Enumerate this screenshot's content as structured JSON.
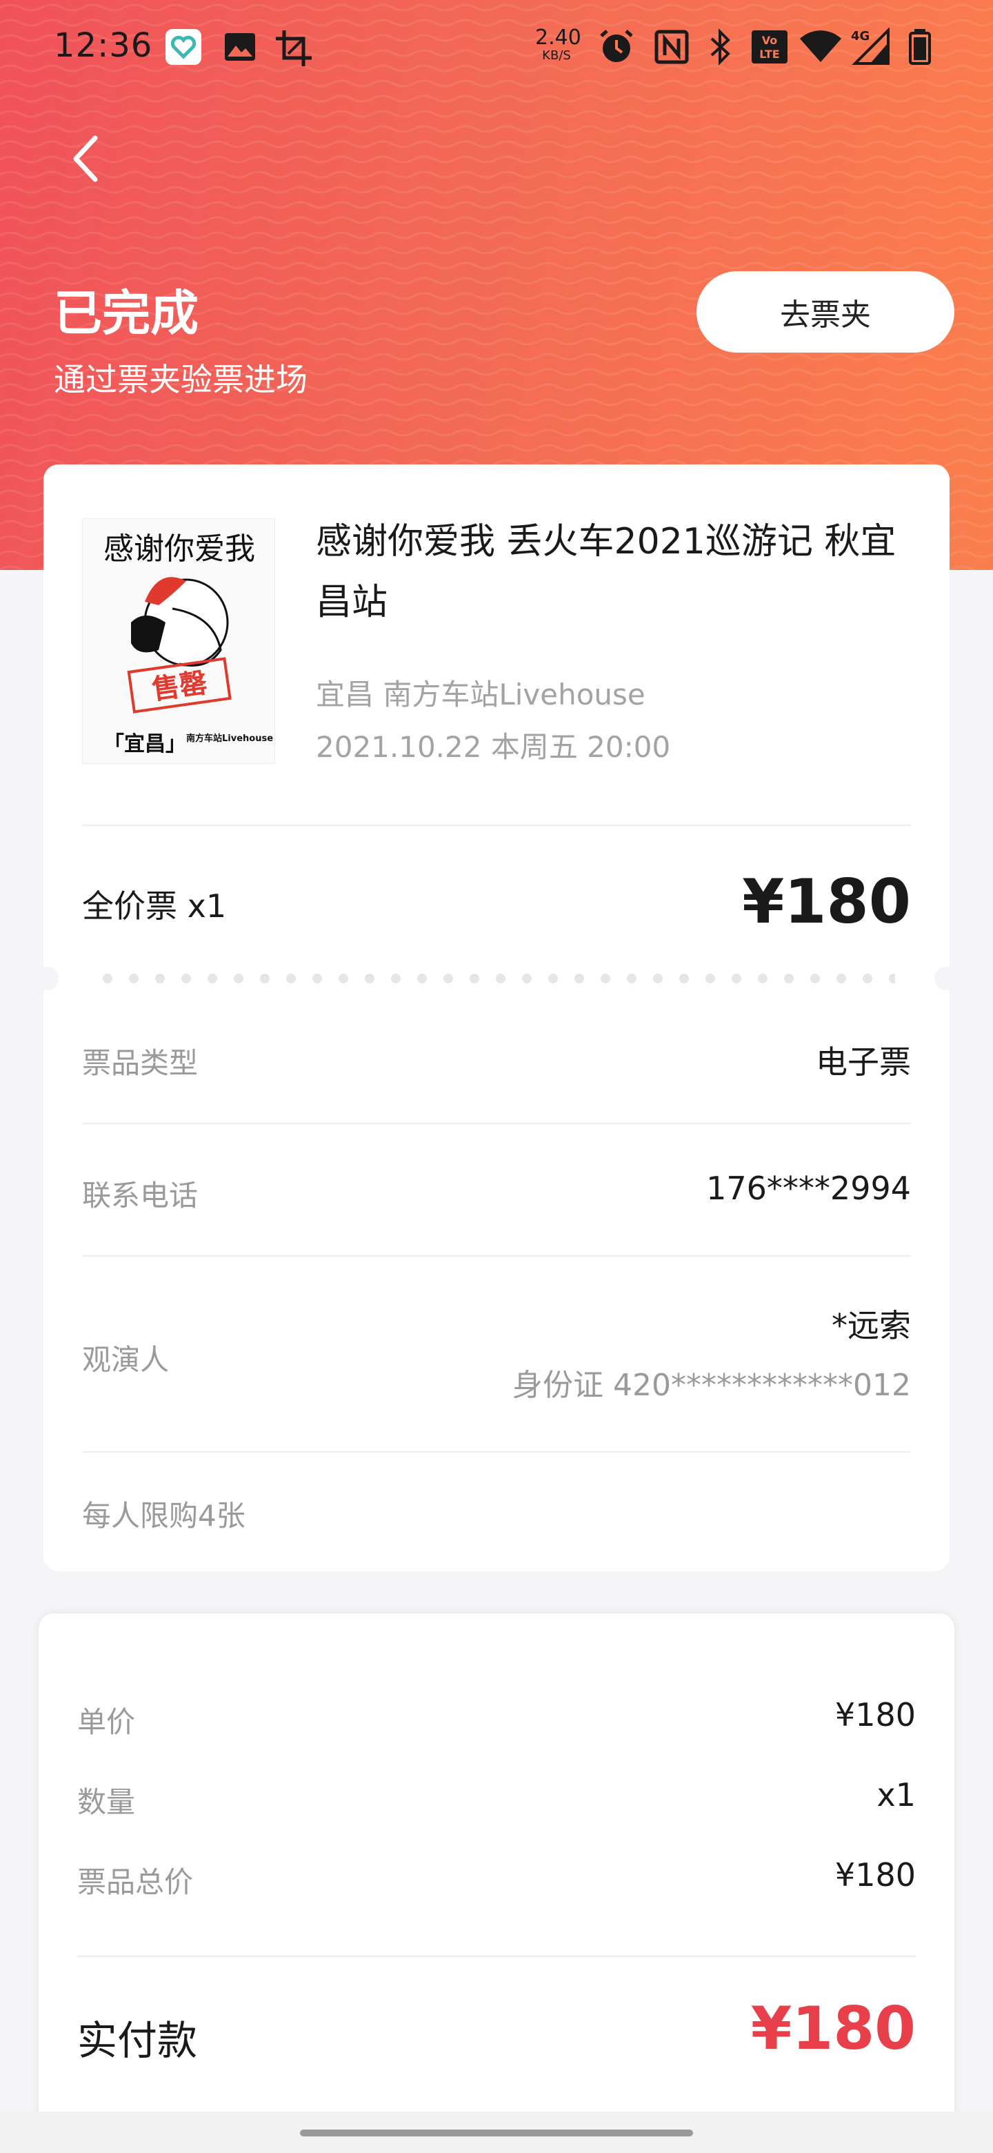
{
  "status_bar": {
    "time": "12:36",
    "net_speed_value": "2.40",
    "net_speed_unit": "KB/S",
    "network_type": "4G",
    "volte": "VoLTE"
  },
  "header": {
    "back_icon": "chevron-left-icon",
    "title": "已完成",
    "subtitle": "通过票夹验票进场",
    "wallet_button": "去票夹"
  },
  "show": {
    "poster_text_top": "感谢你爱我",
    "poster_stamp": "售罄",
    "poster_city": "「宜昌」",
    "poster_venue": "南方车站Livehouse",
    "title": "感谢你爱我 丢火车2021巡游记 秋宜昌站",
    "venue": "宜昌 南方车站Livehouse",
    "datetime": "2021.10.22 本周五 20:00"
  },
  "ticket": {
    "label": "全价票 x1",
    "price": "¥180"
  },
  "details": {
    "type_label": "票品类型",
    "type_value": "电子票",
    "phone_label": "联系电话",
    "phone_value": "176****2994",
    "viewer_label": "观演人",
    "viewer_name": "*远索",
    "viewer_id": "身份证  420************012",
    "limit": "每人限购4张"
  },
  "payment": {
    "unit_label": "单价",
    "unit_value": "¥180",
    "qty_label": "数量",
    "qty_value": "x1",
    "total_label": "票品总价",
    "total_value": "¥180",
    "paid_label": "实付款",
    "paid_value": "¥180"
  },
  "colors": {
    "accent_red": "#e8404a",
    "header_start": "#f0525a",
    "header_end": "#fb7f4d"
  }
}
